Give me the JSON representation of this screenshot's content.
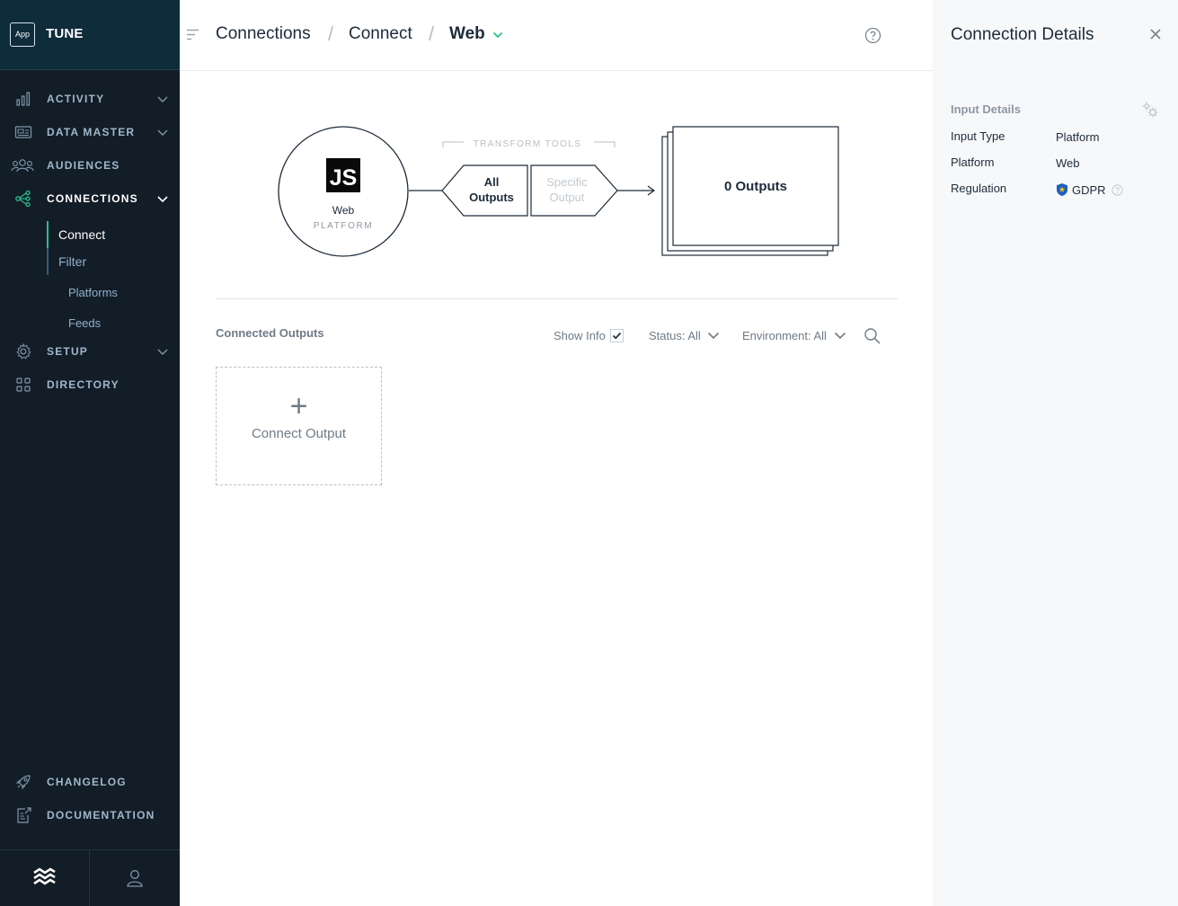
{
  "brand": {
    "app_badge": "App",
    "name": "TUNE"
  },
  "sidebar": {
    "items": [
      {
        "label": "ACTIVITY",
        "icon": "bar-chart-icon",
        "expandable": true
      },
      {
        "label": "DATA MASTER",
        "icon": "data-master-icon",
        "expandable": true
      },
      {
        "label": "AUDIENCES",
        "icon": "audiences-icon",
        "expandable": false
      },
      {
        "label": "CONNECTIONS",
        "icon": "connections-icon",
        "expandable": true,
        "active": true
      },
      {
        "label": "SETUP",
        "icon": "gear-icon",
        "expandable": true
      },
      {
        "label": "DIRECTORY",
        "icon": "grid-icon",
        "expandable": false
      }
    ],
    "connections_sub": [
      {
        "label": "Connect",
        "active": true
      },
      {
        "label": "Filter",
        "active": false
      }
    ],
    "filter_sub": [
      {
        "label": "Platforms"
      },
      {
        "label": "Feeds"
      }
    ],
    "footer_items": [
      {
        "label": "CHANGELOG",
        "icon": "rocket-icon"
      },
      {
        "label": "DOCUMENTATION",
        "icon": "external-doc-icon"
      }
    ]
  },
  "header": {
    "breadcrumbs": [
      "Connections",
      "Connect",
      "Web"
    ],
    "separator": "/"
  },
  "diagram": {
    "input_name": "Web",
    "input_type": "PLATFORM",
    "js_badge": "JS",
    "transform_caption": "TRANSFORM TOOLS",
    "transform_all_line1": "All",
    "transform_all_line2": "Outputs",
    "transform_specific_line1": "Specific",
    "transform_specific_line2": "Output",
    "outputs_label": "0 Outputs"
  },
  "connected_outputs": {
    "title": "Connected Outputs",
    "show_info_label": "Show Info",
    "show_info_checked": true,
    "status_filter": "Status: All",
    "environment_filter": "Environment: All",
    "connect_card_plus": "+",
    "connect_card_label": "Connect Output"
  },
  "details": {
    "title": "Connection Details",
    "section": "Input Details",
    "rows": [
      {
        "label": "Input Type",
        "value": "Platform"
      },
      {
        "label": "Platform",
        "value": "Web"
      },
      {
        "label": "Regulation",
        "value": "GDPR"
      }
    ]
  },
  "colors": {
    "sidebar_bg": "#131d27",
    "brand_bg": "#0f2c3b",
    "accent_green": "#2bbf8f",
    "panel_bg": "#f7f8f9",
    "gdpr_shield": "#1f5fbf"
  }
}
